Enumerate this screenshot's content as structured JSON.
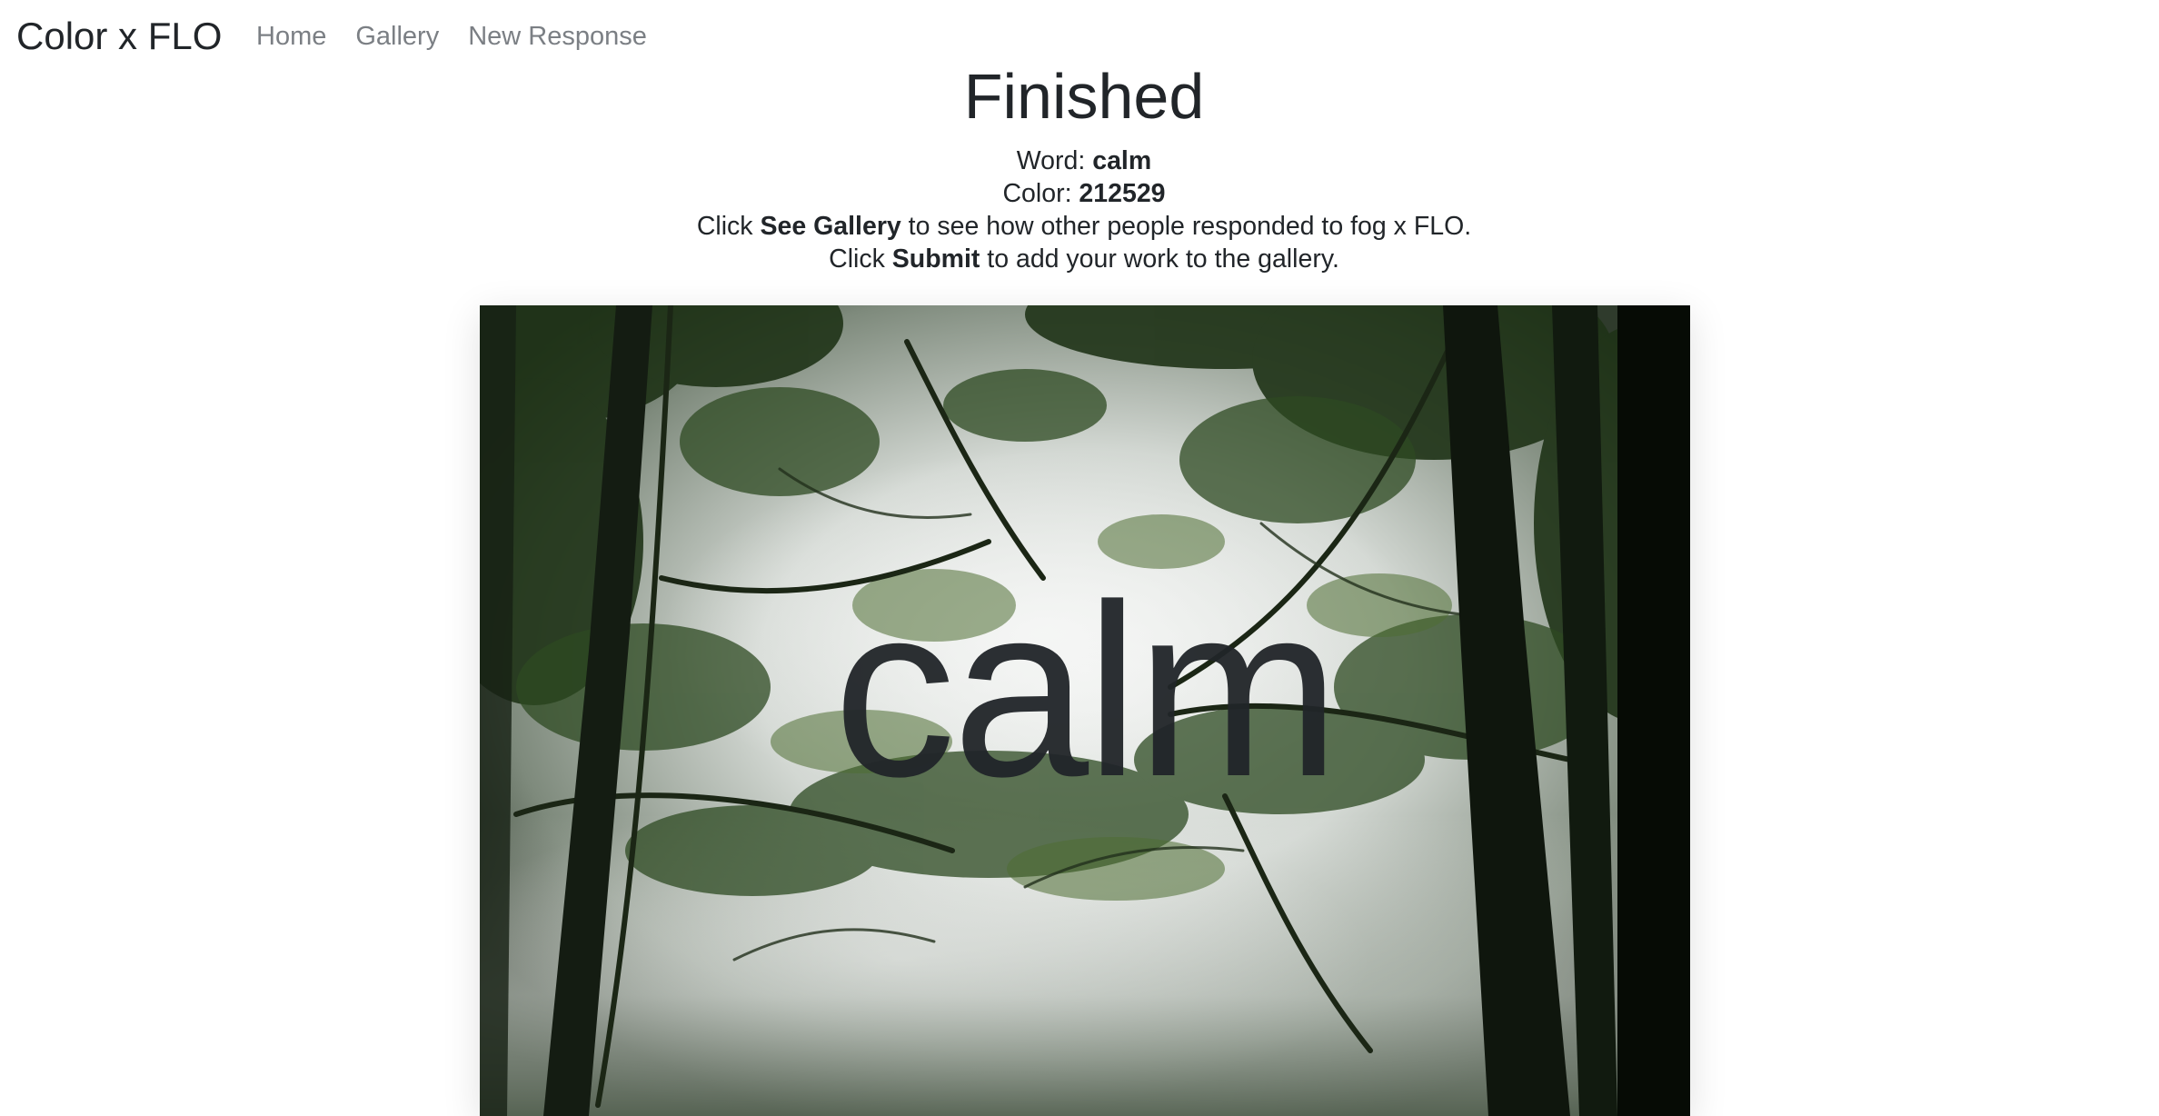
{
  "nav": {
    "brand": "Color x FLO",
    "links": [
      {
        "label": "Home"
      },
      {
        "label": "Gallery"
      },
      {
        "label": "New Response"
      }
    ]
  },
  "page": {
    "title": "Finished",
    "word_label": "Word: ",
    "word_value": "calm",
    "color_label": "Color: ",
    "color_value": "212529",
    "gallery_prefix": "Click ",
    "gallery_bold": "See Gallery",
    "gallery_suffix": " to see how other people responded to fog x FLO.",
    "submit_prefix": "Click ",
    "submit_bold": "Submit",
    "submit_suffix": " to add your work to the gallery."
  },
  "artwork": {
    "overlay_text": "calm",
    "overlay_color": "#212529"
  }
}
